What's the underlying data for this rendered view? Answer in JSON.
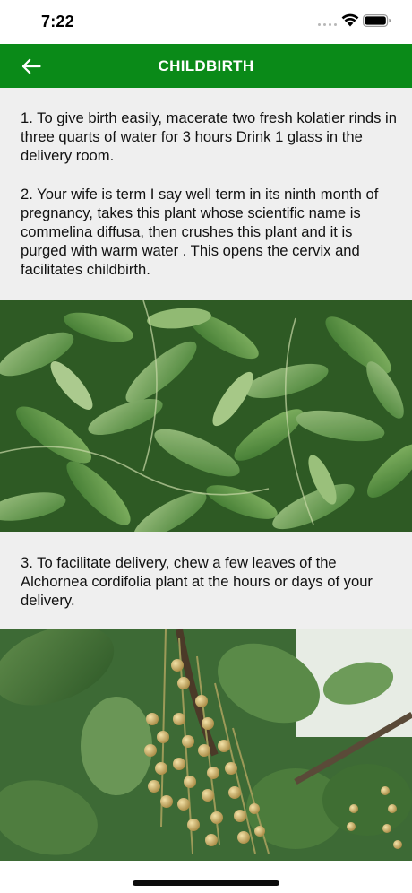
{
  "status_bar": {
    "time": "7:22"
  },
  "header": {
    "title": "CHILDBIRTH",
    "back_icon": "arrow-left-icon"
  },
  "content": {
    "section_1_paragraphs": [
      "1.  To give birth easily, macerate two fresh kolatier rinds in three quarts of water for 3 hours Drink 1 glass in the delivery room.",
      "2. Your wife is term I say well term in its ninth month of pregnancy, takes this plant whose scientific name is commelina diffusa, then crushes this plant and it is purged with warm water . This opens the cervix and facilitates childbirth."
    ],
    "section_2_paragraphs": [
      "3. To facilitate delivery, chew a few leaves of the Alchornea cordifolia plant at the hours or days of your delivery."
    ]
  },
  "colors": {
    "app_bar": "#0a8a18",
    "page_background": "#efefef"
  }
}
